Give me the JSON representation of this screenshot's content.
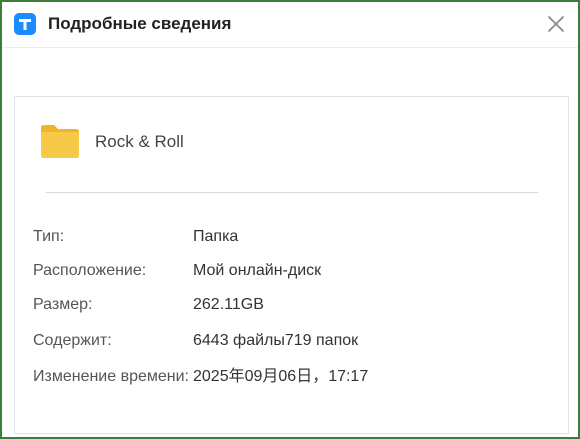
{
  "window": {
    "title": "Подробные сведения",
    "accent_color": "#1a8cff",
    "border_color": "#3c7d3c",
    "app_icon": "app-logo-icon",
    "close_icon": "close-icon"
  },
  "item": {
    "icon": "folder-icon",
    "icon_color": "#f5c33b",
    "name": "Rock & Roll"
  },
  "details": [
    {
      "label": "Тип:",
      "value": "Папка"
    },
    {
      "label": "Расположение:",
      "value": "Мой онлайн-диск"
    },
    {
      "label": "Размер:",
      "value": "262.11GB"
    },
    {
      "label": "Содержит:",
      "value": "6443 файлы719 папок"
    },
    {
      "label": "Изменение времени:",
      "value": "2025年09月06日，17:17"
    }
  ]
}
